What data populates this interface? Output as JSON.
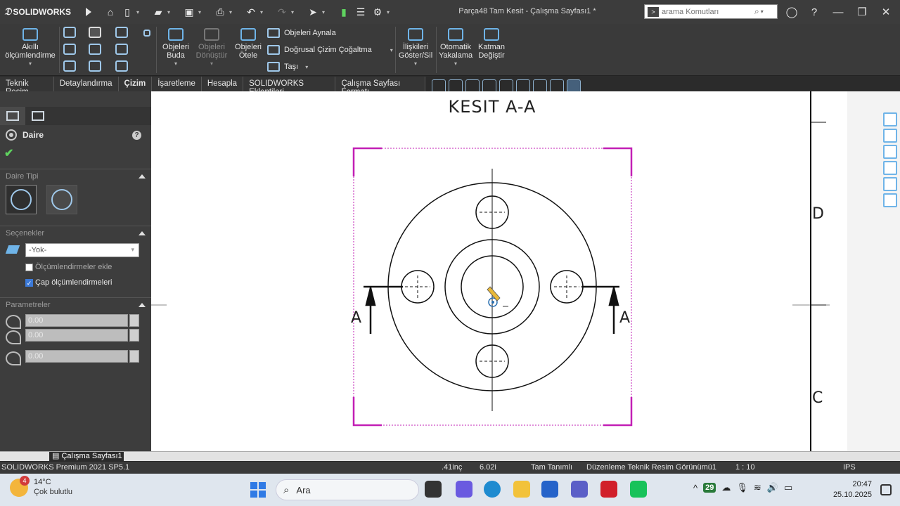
{
  "titlebar": {
    "app_name": "SOLIDWORKS",
    "document_title": "Parça48 Tam Kesit - Çalışma Sayfası1 *",
    "search_placeholder": "arama Komutları"
  },
  "ribbon": {
    "smart_dimension": "Akıllı ölçümlendirme",
    "trim_entities": "Objeleri Buda",
    "convert_entities": "Objeleri Dönüştür",
    "offset_entities": "Objeleri Ötele",
    "mirror_entities": "Objeleri Aynala",
    "linear_pattern": "Doğrusal Çizim Çoğaltma",
    "move_entities": "Taşı",
    "display_relations": "İlişkileri Göster/Sil",
    "quick_snaps": "Otomatik Yakalama",
    "change_layer": "Katman Değiştir"
  },
  "tabs": [
    {
      "label": "Teknik Resim",
      "active": false
    },
    {
      "label": "Detaylandırma",
      "active": false
    },
    {
      "label": "Çizim",
      "active": true
    },
    {
      "label": "İşaretleme",
      "active": false
    },
    {
      "label": "Hesapla",
      "active": false
    },
    {
      "label": "SOLIDWORKS Eklentileri",
      "active": false
    },
    {
      "label": "Çalışma Sayfası Formatı",
      "active": false
    }
  ],
  "property_manager": {
    "title": "Daire",
    "groups": {
      "circle_type": "Daire Tipi",
      "options": "Seçenekler",
      "parameters": "Parametreler"
    },
    "layer_value": "-Yok-",
    "add_dimensions_label": "Ölçümlendirmeler ekle",
    "add_dimensions_checked": false,
    "diameter_dimension_label": "Çap ölçümlendirmeleri",
    "diameter_dimension_checked": true,
    "param_cx": "0.00",
    "param_cy": "0.00",
    "param_radius": "0.00"
  },
  "drawing": {
    "section_title": "KESIT A-A",
    "section_label_left": "A",
    "section_label_right": "A",
    "zone_d": "D",
    "zone_c": "C",
    "colors": {
      "border": "#c21fb5",
      "lines": "#111111",
      "cursor": "#e8b83a",
      "center_mark": "#2a6fb0"
    }
  },
  "sheetbar": {
    "sheet_tab": "Çalışma Sayfası1"
  },
  "statusbar": {
    "product": "SOLIDWORKS Premium 2021 SP5.1",
    "x": ".41inç",
    "y": "6.02i",
    "state": "Tam Tanımlı",
    "mode": "Düzenleme Teknik Resim Görünümü1",
    "scale": "1 : 10",
    "units": "IPS"
  },
  "taskbar": {
    "weather_temp": "14°C",
    "weather_desc": "Çok bulutlu",
    "weather_badge": "4",
    "search_label": "Ara",
    "tray_badge": "29",
    "time": "20:47",
    "date": "25.10.2025"
  }
}
